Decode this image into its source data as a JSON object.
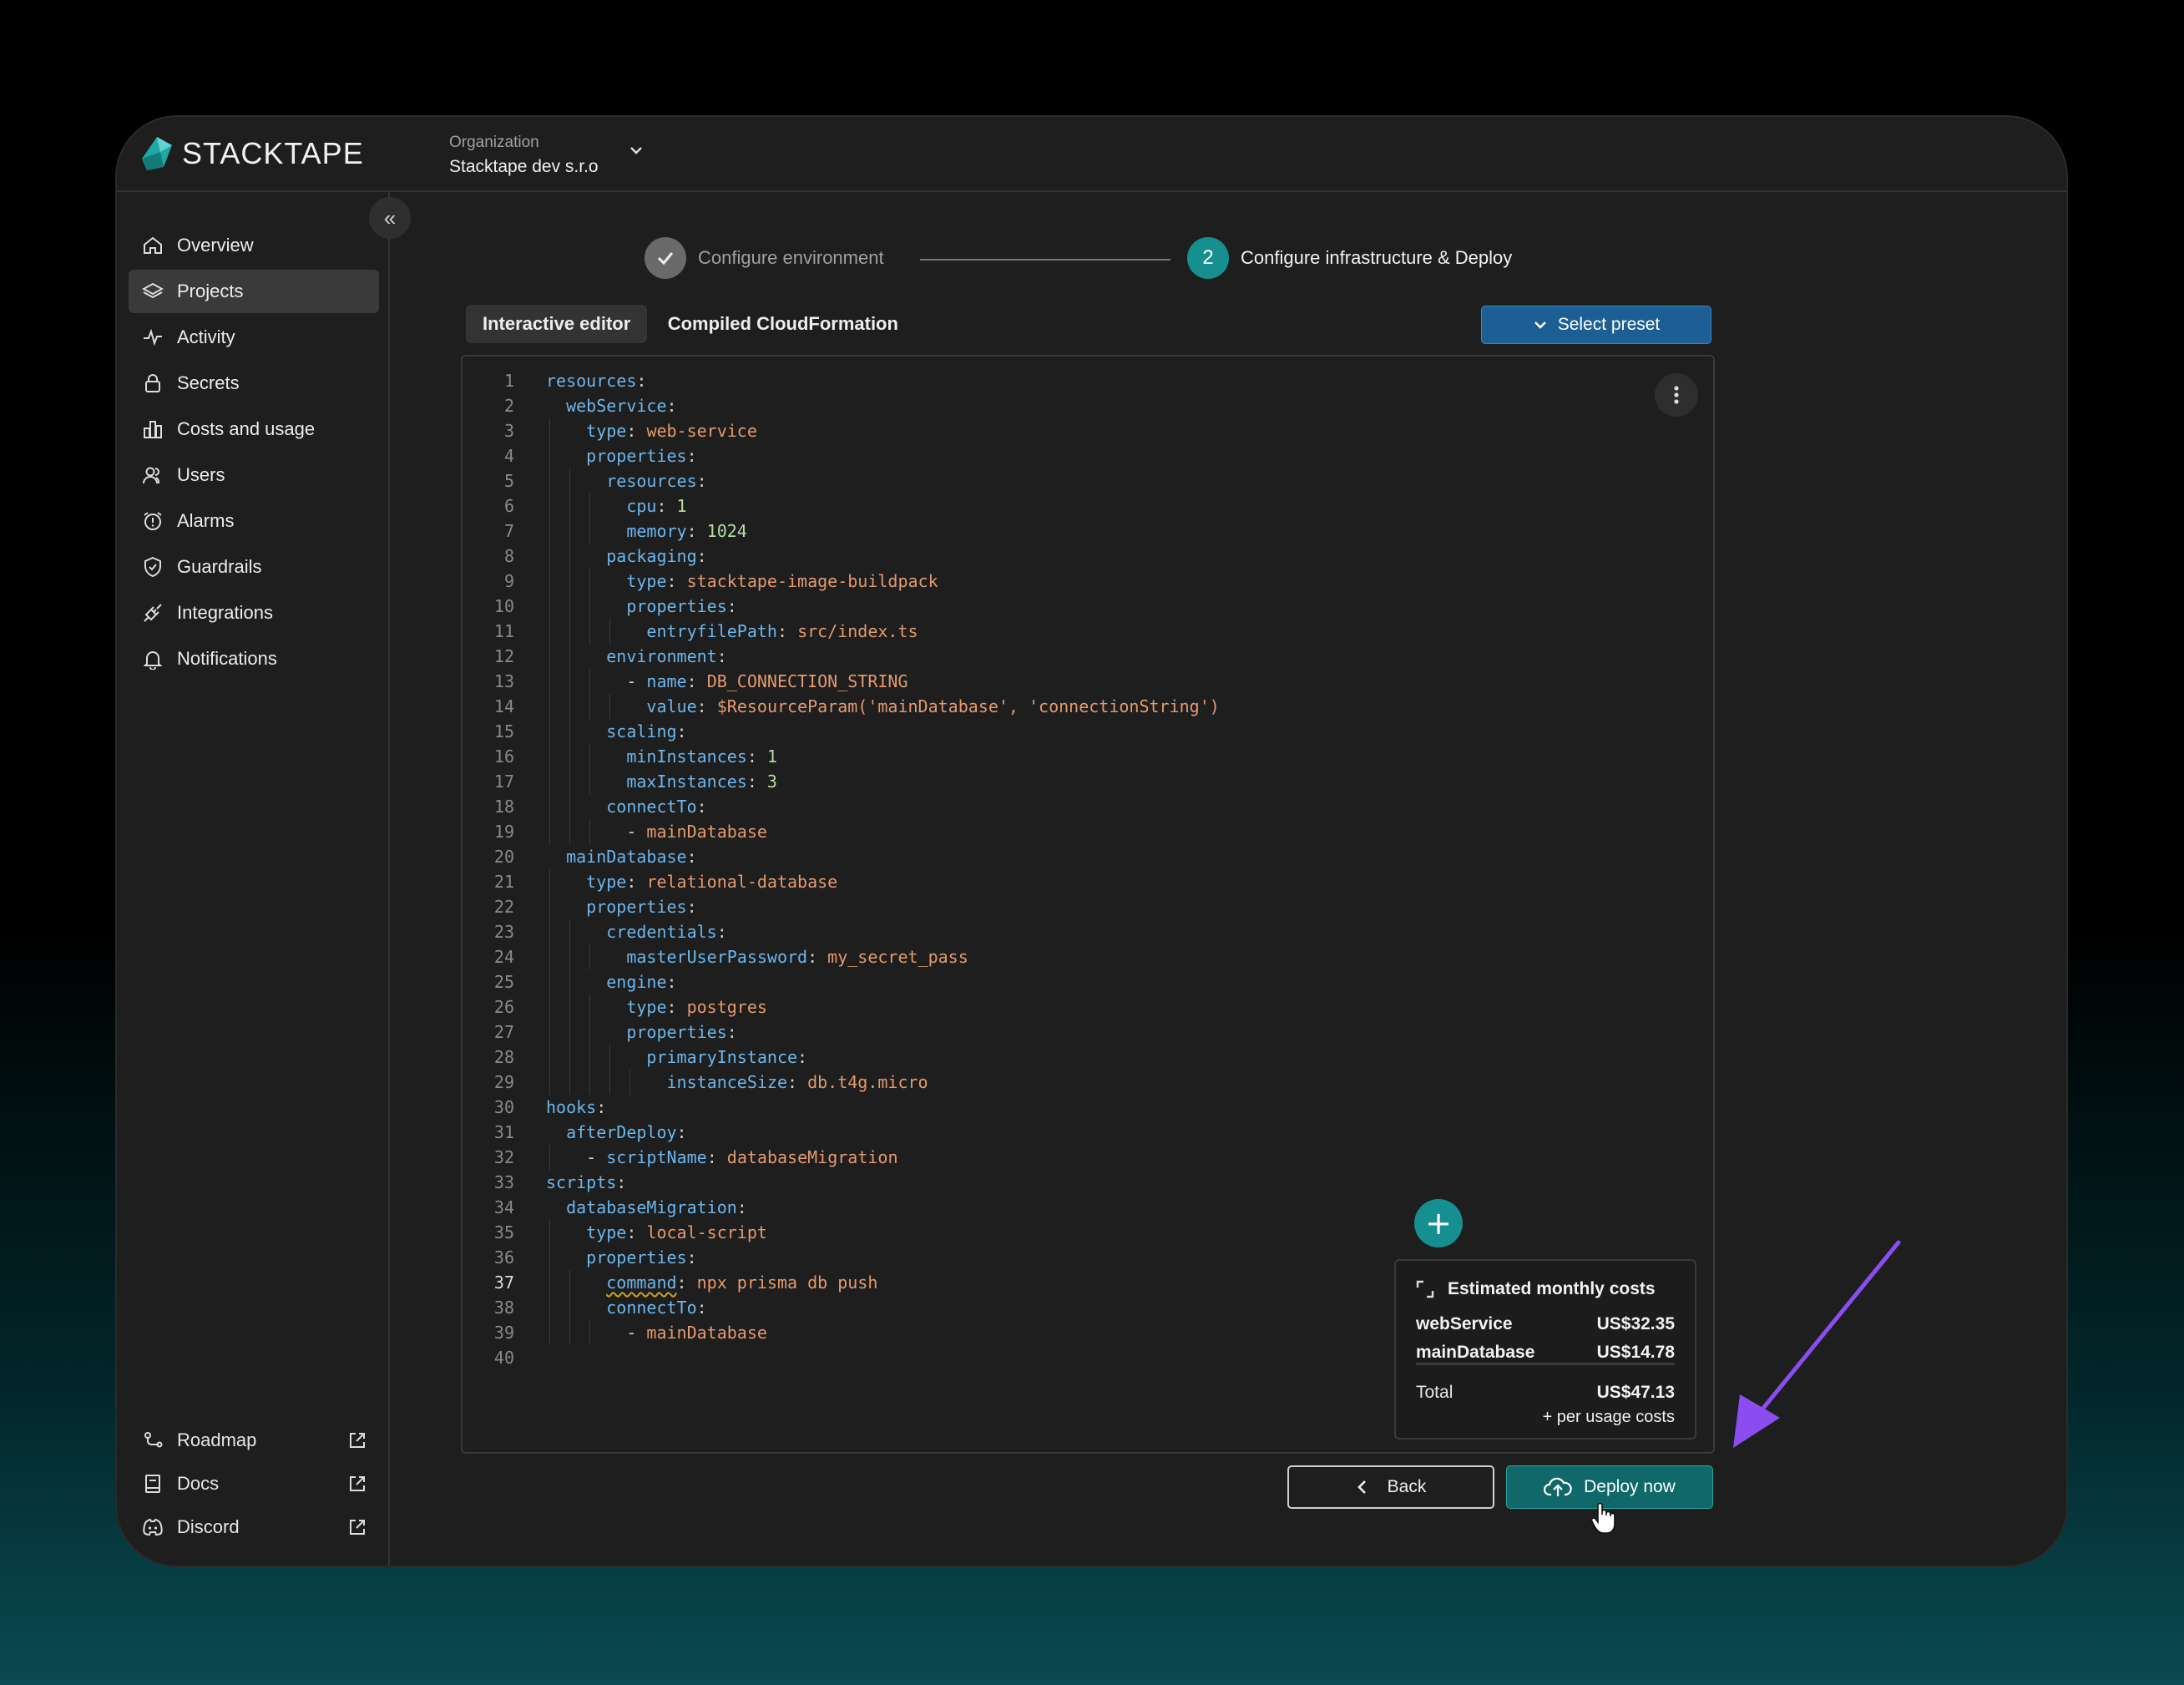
{
  "app": {
    "brand": "STACKTAPE"
  },
  "org": {
    "label": "Organization",
    "name": "Stacktape dev s.r.o"
  },
  "sidebar": {
    "collapse_icon": "«",
    "items": [
      {
        "label": "Overview",
        "icon": "home-icon"
      },
      {
        "label": "Projects",
        "icon": "layers-icon",
        "active": true
      },
      {
        "label": "Activity",
        "icon": "activity-icon"
      },
      {
        "label": "Secrets",
        "icon": "lock-icon"
      },
      {
        "label": "Costs and usage",
        "icon": "bar-chart-icon"
      },
      {
        "label": "Users",
        "icon": "users-icon"
      },
      {
        "label": "Alarms",
        "icon": "alarm-icon"
      },
      {
        "label": "Guardrails",
        "icon": "shield-icon"
      },
      {
        "label": "Integrations",
        "icon": "plug-icon"
      },
      {
        "label": "Notifications",
        "icon": "bell-icon"
      }
    ],
    "bottom": [
      {
        "label": "Roadmap",
        "icon": "roadmap-icon"
      },
      {
        "label": "Docs",
        "icon": "docs-icon"
      },
      {
        "label": "Discord",
        "icon": "discord-icon"
      }
    ]
  },
  "stepper": {
    "step1": {
      "label": "Configure environment",
      "state": "done"
    },
    "step2": {
      "number": "2",
      "label": "Configure infrastructure & Deploy",
      "state": "active"
    }
  },
  "tabs": {
    "interactive": "Interactive editor",
    "compiled": "Compiled CloudFormation"
  },
  "preset": {
    "label": "Select preset"
  },
  "editor": {
    "current_line": 37,
    "lines": [
      "resources:",
      "  webService:",
      "    type: web-service",
      "    properties:",
      "      resources:",
      "        cpu: 1",
      "        memory: 1024",
      "      packaging:",
      "        type: stacktape-image-buildpack",
      "        properties:",
      "          entryfilePath: src/index.ts",
      "      environment:",
      "        - name: DB_CONNECTION_STRING",
      "          value: $ResourceParam('mainDatabase', 'connectionString')",
      "      scaling:",
      "        minInstances: 1",
      "        maxInstances: 3",
      "      connectTo:",
      "        - mainDatabase",
      "  mainDatabase:",
      "    type: relational-database",
      "    properties:",
      "      credentials:",
      "        masterUserPassword: my_secret_pass",
      "      engine:",
      "        type: postgres",
      "        properties:",
      "          primaryInstance:",
      "            instanceSize: db.t4g.micro",
      "hooks:",
      "  afterDeploy:",
      "    - scriptName: databaseMigration",
      "scripts:",
      "  databaseMigration:",
      "    type: local-script",
      "    properties:",
      "      command: npx prisma db push",
      "      connectTo:",
      "        - mainDatabase",
      ""
    ]
  },
  "costs": {
    "title": "Estimated monthly costs",
    "items": [
      {
        "name": "webService",
        "value": "US$32.35"
      },
      {
        "name": "mainDatabase",
        "value": "US$14.78"
      }
    ],
    "total_label": "Total",
    "total_value": "US$47.13",
    "note": "+ per usage costs"
  },
  "actions": {
    "back": "Back",
    "deploy": "Deploy now"
  },
  "colors": {
    "accent": "#158f8f",
    "preset": "#1d5f94",
    "annotation_arrow": "#8b4df0"
  }
}
